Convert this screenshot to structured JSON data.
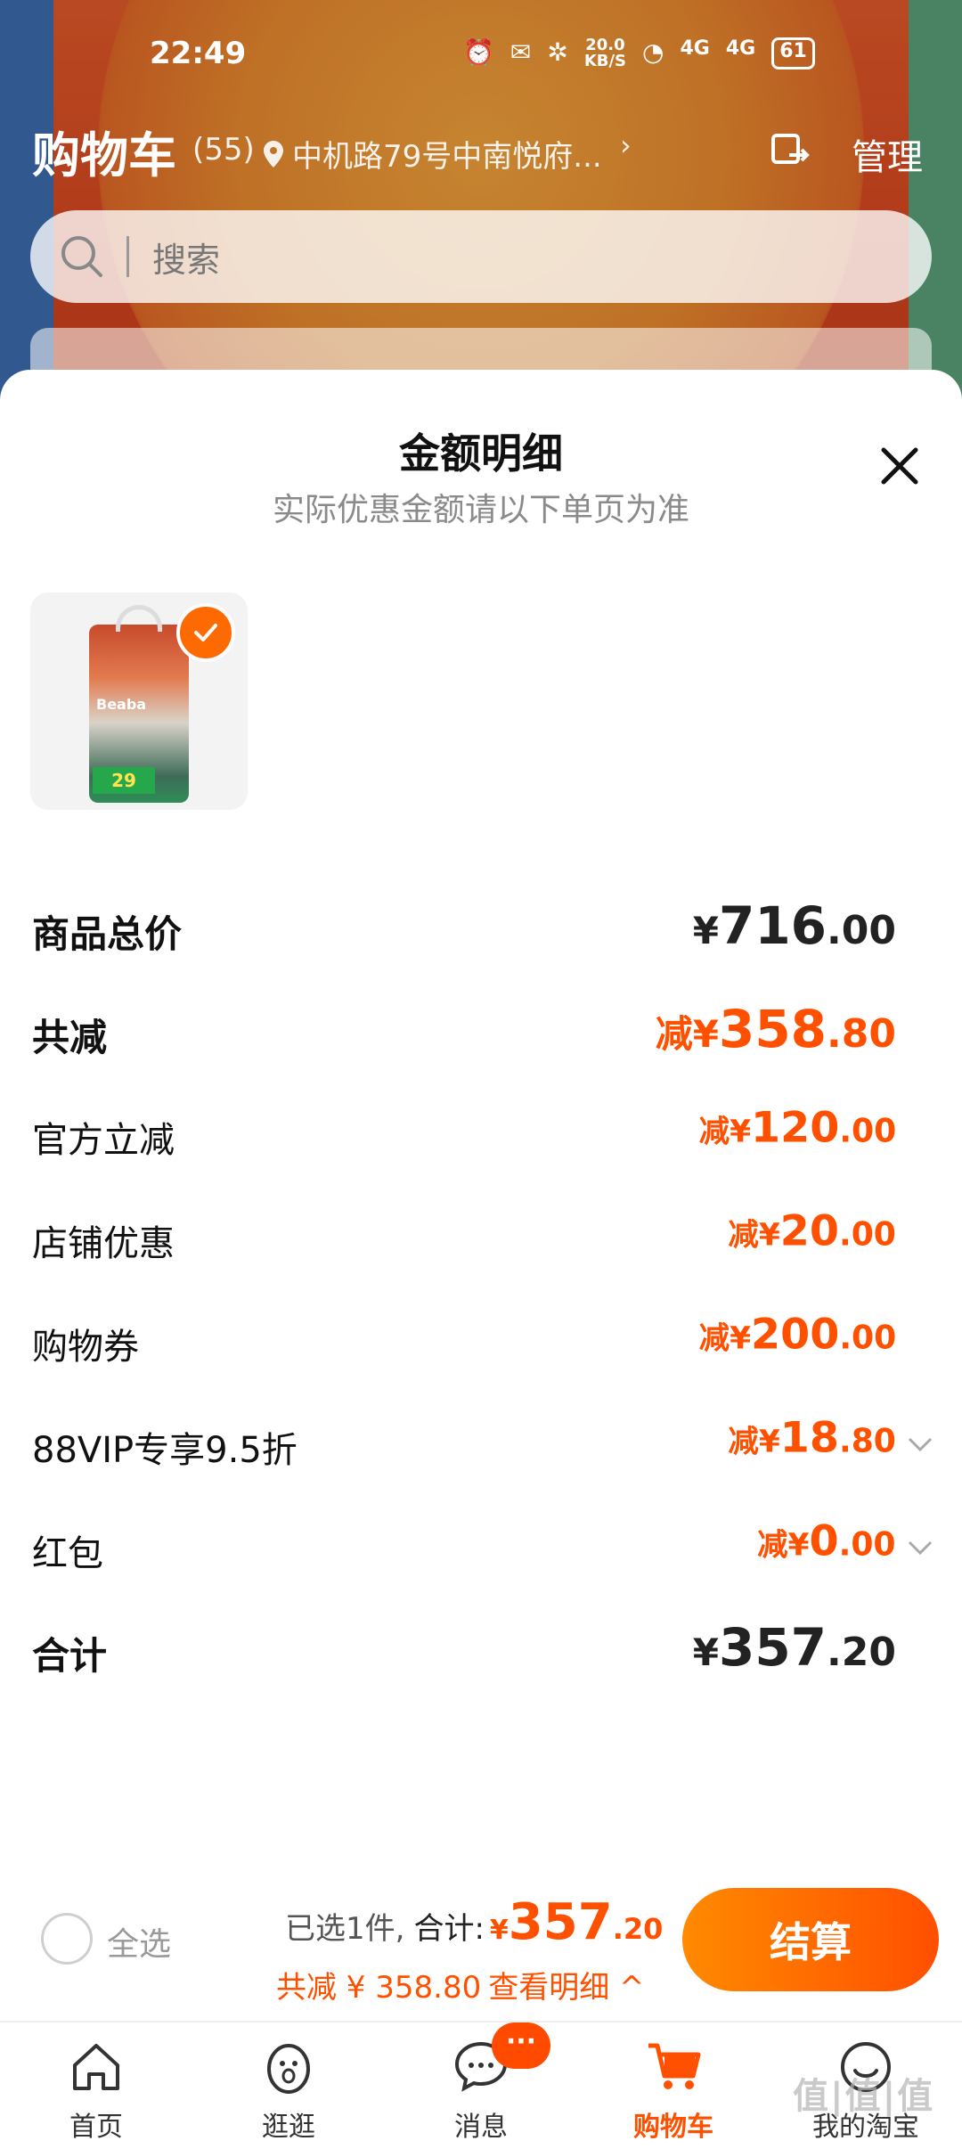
{
  "status_bar": {
    "time": "22:49",
    "net_speed": "20.0\nKB/S",
    "signal1": "4G",
    "signal2": "4G",
    "battery": "61"
  },
  "header": {
    "title": "购物车",
    "count": "(55)",
    "address": "中机路79号中南悦府...",
    "address_arrow": "›",
    "manage_label": "管理"
  },
  "search": {
    "placeholder": "搜索"
  },
  "sheet": {
    "title": "金额明细",
    "subtitle": "实际优惠金额请以下单页为准",
    "product": {
      "brand_text": "Beaba",
      "badge_text": "29"
    },
    "rows": [
      {
        "label": "商品总价",
        "prefix": "¥",
        "int": "716",
        "dec": ".00"
      },
      {
        "label": "共减",
        "prefix": "减¥",
        "int": "358",
        "dec": ".80"
      },
      {
        "label": "官方立减",
        "prefix": "减¥",
        "int": "120",
        "dec": ".00"
      },
      {
        "label": "店铺优惠",
        "prefix": "减¥",
        "int": "20",
        "dec": ".00"
      },
      {
        "label": "购物券",
        "prefix": "减¥",
        "int": "200",
        "dec": ".00"
      },
      {
        "label": "88VIP专享9.5折",
        "prefix": "减¥",
        "int": "18",
        "dec": ".80"
      },
      {
        "label": "红包",
        "prefix": "减¥",
        "int": "0",
        "dec": ".00"
      },
      {
        "label": "合计",
        "prefix": "¥",
        "int": "357",
        "dec": ".20"
      }
    ]
  },
  "checkout": {
    "select_all": "全选",
    "selected_count": "已选1件,",
    "total_label": "合计:",
    "total_prefix": "¥",
    "total_int": "357",
    "total_dec": ".20",
    "discount_text": "共减 ¥ 358.80",
    "view_detail": "查看明细 ^",
    "button_label": "结算"
  },
  "tabs": [
    {
      "label": "首页"
    },
    {
      "label": "逛逛"
    },
    {
      "label": "消息"
    },
    {
      "label": "购物车"
    },
    {
      "label": "我的淘宝"
    }
  ],
  "message_badge": "···",
  "watermark": "值|值|值",
  "colors": {
    "accent": "#ff5000",
    "button_start": "#ff8a00",
    "button_end": "#ff4f00",
    "header_bg": "#e25a2a"
  }
}
